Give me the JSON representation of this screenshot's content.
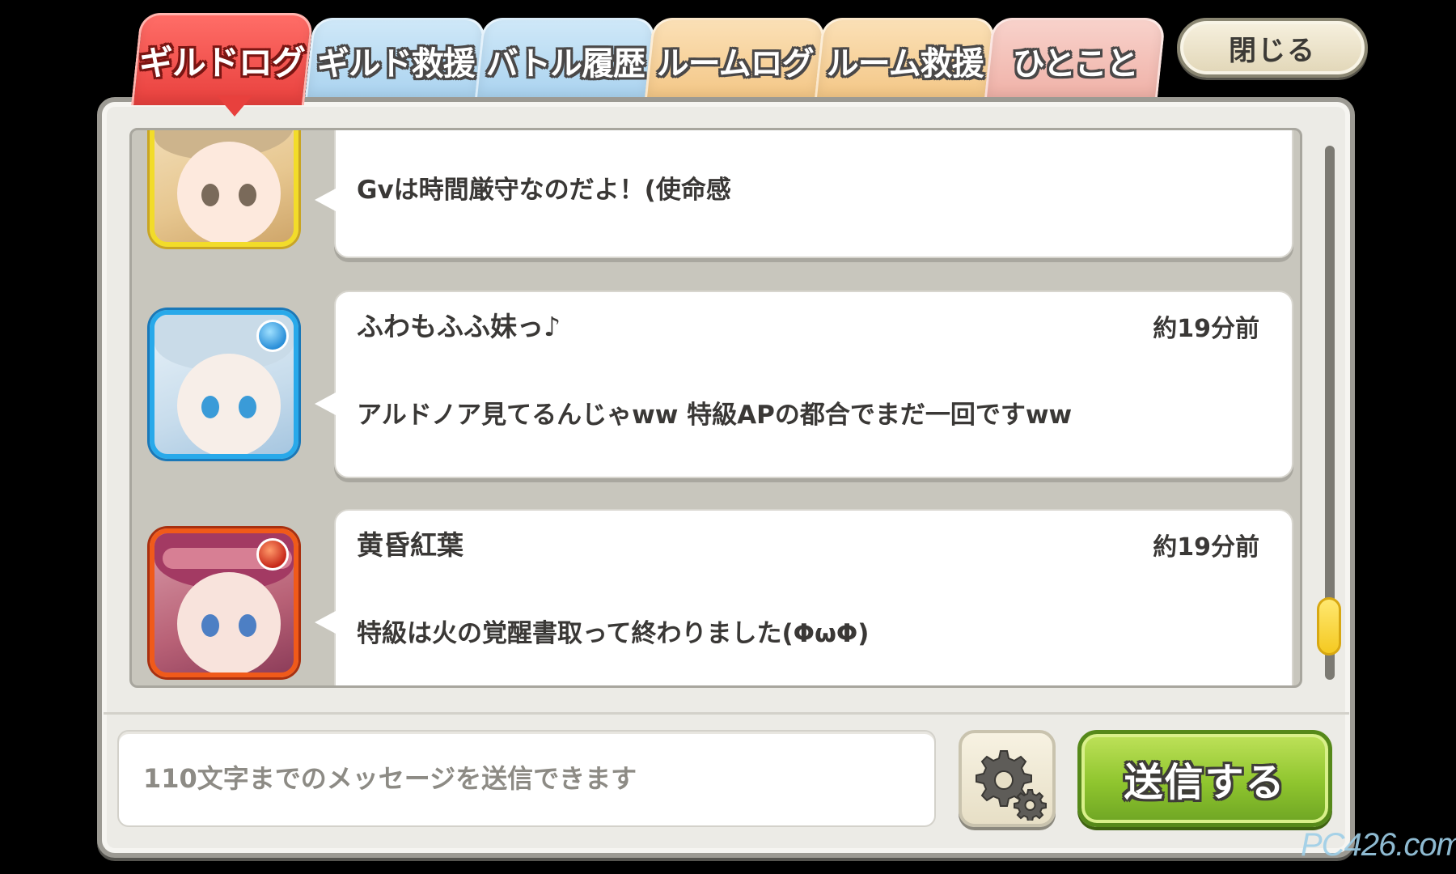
{
  "tabs": [
    {
      "label": "ギルドログ",
      "active": true,
      "color": "#e8403d"
    },
    {
      "label": "ギルド救援",
      "active": false,
      "color": "#a9d2ef"
    },
    {
      "label": "バトル履歴",
      "active": false,
      "color": "#a9d2ef"
    },
    {
      "label": "ルームログ",
      "active": false,
      "color": "#f3c685"
    },
    {
      "label": "ルーム救援",
      "active": false,
      "color": "#f3c685"
    },
    {
      "label": "ひとこと",
      "active": false,
      "color": "#efb0a6"
    }
  ],
  "close_label": "閉じる",
  "messages": [
    {
      "name": "",
      "time": "",
      "text": "Gvは時間厳守なのだよ！(使命感",
      "frame": "yellow",
      "element": ""
    },
    {
      "name": "ふわもふふ妹っ♪",
      "time": "約19分前",
      "text": "アルドノア見てるんじゃww 特級APの都合でまだ一回ですww",
      "frame": "blue",
      "element": "water"
    },
    {
      "name": "黄昏紅葉",
      "time": "約19分前",
      "text": "特級は火の覚醒書取って終わりました(ΦωΦ)",
      "frame": "red",
      "element": "fire"
    }
  ],
  "input": {
    "placeholder": "110文字までのメッセージを送信できます",
    "value": ""
  },
  "settings_icon": "gear-icon",
  "send_label": "送信する",
  "watermark": "PC426.com"
}
